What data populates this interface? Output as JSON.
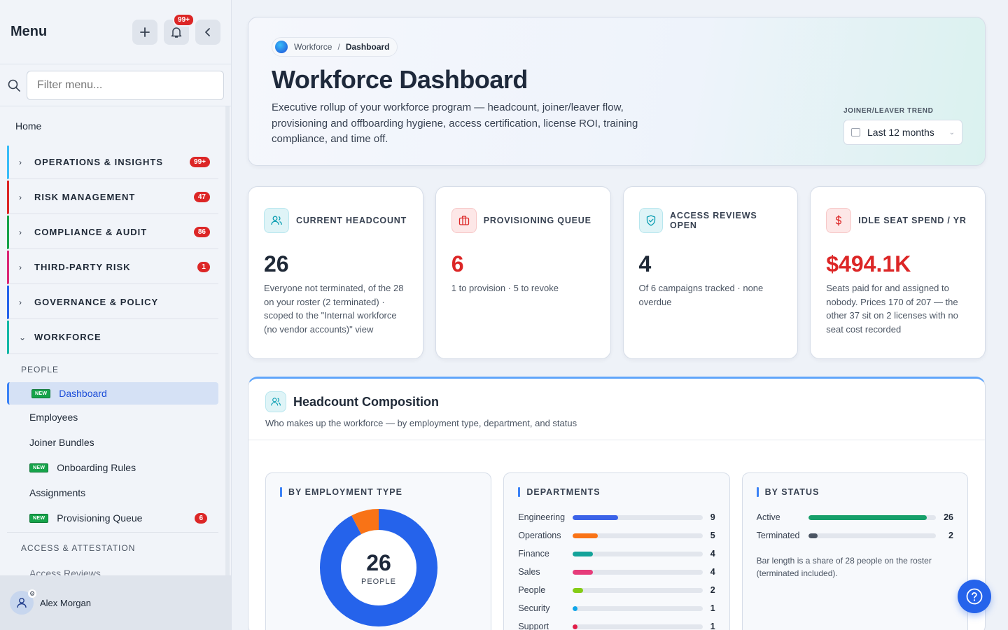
{
  "sidebar": {
    "title": "Menu",
    "notifications_badge": "99+",
    "filter_placeholder": "Filter menu...",
    "home": "Home",
    "groups": [
      {
        "label": "OPERATIONS & INSIGHTS",
        "badge": "99+",
        "color": "#38bdf8"
      },
      {
        "label": "RISK MANAGEMENT",
        "badge": "47",
        "color": "#dc2626"
      },
      {
        "label": "COMPLIANCE & AUDIT",
        "badge": "86",
        "color": "#16a34a"
      },
      {
        "label": "THIRD-PARTY RISK",
        "badge": "1",
        "color": "#db2777"
      },
      {
        "label": "GOVERNANCE & POLICY",
        "badge": "",
        "color": "#2563eb"
      },
      {
        "label": "WORKFORCE",
        "badge": "",
        "color": "#14b8a6"
      }
    ],
    "people_header": "PEOPLE",
    "new_tag": "NEW",
    "items": [
      {
        "label": "Dashboard"
      },
      {
        "label": "Employees"
      },
      {
        "label": "Joiner Bundles"
      },
      {
        "label": "Onboarding Rules"
      },
      {
        "label": "Assignments"
      },
      {
        "label": "Provisioning Queue",
        "badge": "6"
      }
    ],
    "access_header": "ACCESS & ATTESTATION",
    "access_items": [
      {
        "label": "Access Reviews"
      }
    ],
    "user": "Alex Morgan"
  },
  "hero": {
    "crumb_parent": "Workforce",
    "crumb_sep": "/",
    "crumb_current": "Dashboard",
    "title": "Workforce Dashboard",
    "description": "Executive rollup of your workforce program — headcount, joiner/leaver flow, provisioning and offboarding hygiene, access certification, license ROI, training compliance, and time off.",
    "trend_label": "JOINER/LEAVER TREND",
    "trend_value": "Last 12 months"
  },
  "kpis": [
    {
      "label": "CURRENT HEADCOUNT",
      "value": "26",
      "desc": "Everyone not terminated, of the 28 on your roster (2 terminated) · scoped to the \"Internal workforce (no vendor accounts)\" view"
    },
    {
      "label": "PROVISIONING QUEUE",
      "value": "6",
      "desc": "1 to provision · 5 to revoke"
    },
    {
      "label": "ACCESS REVIEWS OPEN",
      "value": "4",
      "desc": "Of 6 campaigns tracked · none overdue"
    },
    {
      "label": "IDLE SEAT SPEND / YR",
      "value": "$494.1K",
      "desc": "Seats paid for and assigned to nobody. Prices 170 of 207 — the other 37 sit on 2 licenses with no seat cost recorded"
    }
  ],
  "composition": {
    "title": "Headcount Composition",
    "subtitle": "Who makes up the workforce — by employment type, department, and status",
    "employment_header": "BY EMPLOYMENT TYPE",
    "donut_total": "26",
    "donut_label": "PEOPLE",
    "employment_split": [
      {
        "value": 24,
        "color": "#2563eb"
      },
      {
        "value": 2,
        "color": "#f97316"
      }
    ],
    "departments_header": "DEPARTMENTS",
    "departments_max": 26,
    "departments": [
      {
        "name": "Engineering",
        "count": "9",
        "value": 9,
        "color": "#3b63e8"
      },
      {
        "name": "Operations",
        "count": "5",
        "value": 5,
        "color": "#f97316"
      },
      {
        "name": "Finance",
        "count": "4",
        "value": 4,
        "color": "#14a39a"
      },
      {
        "name": "Sales",
        "count": "4",
        "value": 4,
        "color": "#e63c7a"
      },
      {
        "name": "People",
        "count": "2",
        "value": 2,
        "color": "#84cc16"
      },
      {
        "name": "Security",
        "count": "1",
        "value": 1,
        "color": "#0ea5e9"
      },
      {
        "name": "Support",
        "count": "1",
        "value": 1,
        "color": "#e11d48"
      }
    ],
    "status_header": "BY STATUS",
    "status_max": 28,
    "statuses": [
      {
        "name": "Active",
        "count": "26",
        "value": 26,
        "color": "#16a06a"
      },
      {
        "name": "Terminated",
        "count": "2",
        "value": 2,
        "color": "#4b5563"
      }
    ],
    "status_note": "Bar length is a share of 28 people on the roster (terminated included)."
  }
}
